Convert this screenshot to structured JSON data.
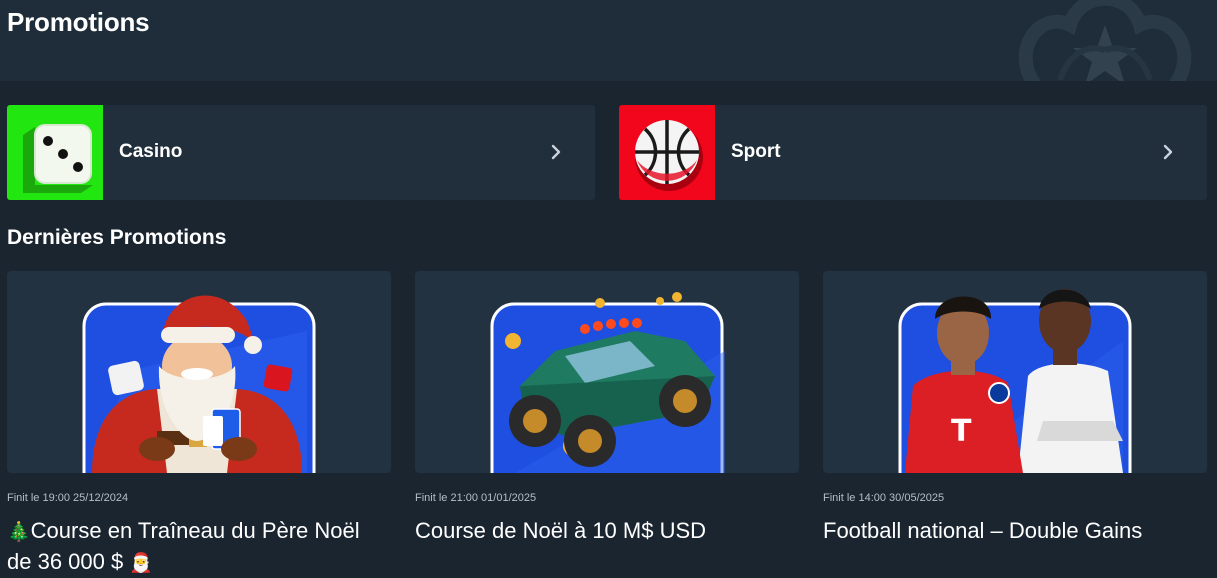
{
  "header": {
    "title": "Promotions"
  },
  "categories": [
    {
      "label": "Casino",
      "icon": "dice-icon",
      "color": "#22e60f"
    },
    {
      "label": "Sport",
      "icon": "basketball-icon",
      "color": "#f2061c"
    }
  ],
  "section": {
    "title": "Dernières Promotions"
  },
  "promotions": [
    {
      "ends": "Finit le 19:00 25/12/2024",
      "lead_emoji": "🎄",
      "title": "Course en Traîneau du Père Noël",
      "title_line2": "de 36 000 $",
      "trail_emoji": "🎅",
      "image": "santa-illustration"
    },
    {
      "ends": "Finit le 21:00 01/01/2025",
      "title": "Course de Noël à 10 M$ USD",
      "image": "monster-truck-illustration"
    },
    {
      "ends": "Finit le 14:00 30/05/2025",
      "title": "Football national – Double Gains",
      "image": "football-players-illustration"
    }
  ],
  "colors": {
    "background": "#1a2530",
    "card": "#202f3b",
    "accent_blue": "#1f4fe0"
  }
}
